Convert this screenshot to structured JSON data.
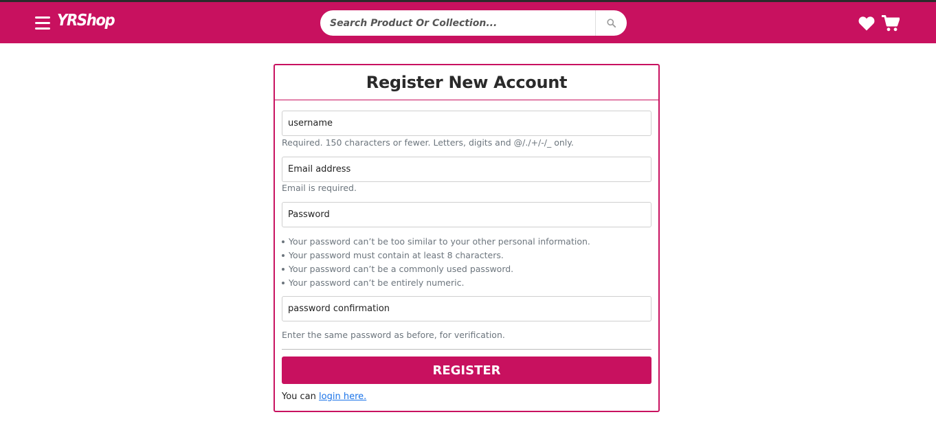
{
  "header": {
    "brand": "YRShop",
    "search_placeholder": "Search Product Or Collection...",
    "menu_icon": "hamburger-icon",
    "search_icon": "search-icon",
    "wishlist_icon": "heart-icon",
    "cart_icon": "cart-icon",
    "accent_color": "#c8115f"
  },
  "form": {
    "title": "Register New Account",
    "username_placeholder": "username",
    "username_help": "Required. 150 characters or fewer. Letters, digits and @/./+/-/_ only.",
    "email_placeholder": "Email address",
    "email_help": "Email is required.",
    "password_placeholder": "Password",
    "password_rules": [
      "Your password can’t be too similar to your other personal information.",
      "Your password must contain at least 8 characters.",
      "Your password can’t be a commonly used password.",
      "Your password can’t be entirely numeric."
    ],
    "confirm_placeholder": "password confirmation",
    "confirm_help": "Enter the same password as before, for verification.",
    "submit_label": "REGISTER",
    "login_prefix": "You can",
    "login_link": "login here."
  }
}
